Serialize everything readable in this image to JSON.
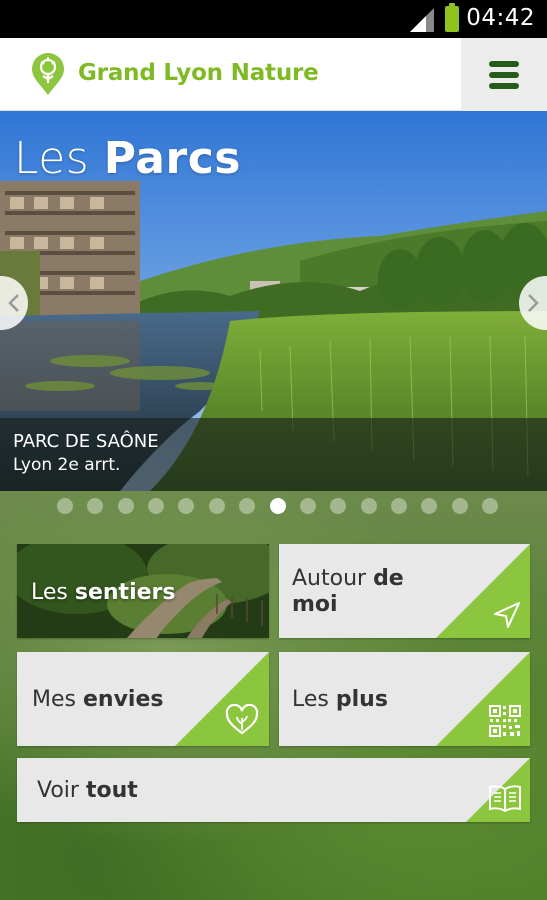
{
  "status_bar": {
    "time": "04:42",
    "battery_color": "#8fc31f"
  },
  "app_bar": {
    "brand": "Grand Lyon Nature",
    "logo_icon": "leaf-pin-icon",
    "menu_icon": "hamburger-menu-icon",
    "brand_color": "#7fba25",
    "menu_color": "#255c1b"
  },
  "carousel": {
    "heading_light": "Les ",
    "heading_bold": "Parcs",
    "caption_name": "PARC DE SAÔNE",
    "caption_place": "Lyon 2e arrt.",
    "prev_icon": "chevron-left-icon",
    "next_icon": "chevron-right-icon",
    "dots_total": 15,
    "active_dot": 8
  },
  "tiles": {
    "sentiers": {
      "light": "Les ",
      "bold": "sentiers"
    },
    "autour": {
      "light": "Autour ",
      "bold_1": "de",
      "bold_2": "moi",
      "icon": "location-arrow-icon"
    },
    "envies": {
      "light": "Mes ",
      "bold": "envies",
      "icon": "heart-leaf-icon"
    },
    "plus": {
      "light": "Les ",
      "bold": "plus",
      "icon": "qr-code-icon"
    },
    "tout": {
      "light": "Voir ",
      "bold": "tout",
      "icon": "open-book-icon"
    },
    "accent_color": "#8cc63f"
  }
}
